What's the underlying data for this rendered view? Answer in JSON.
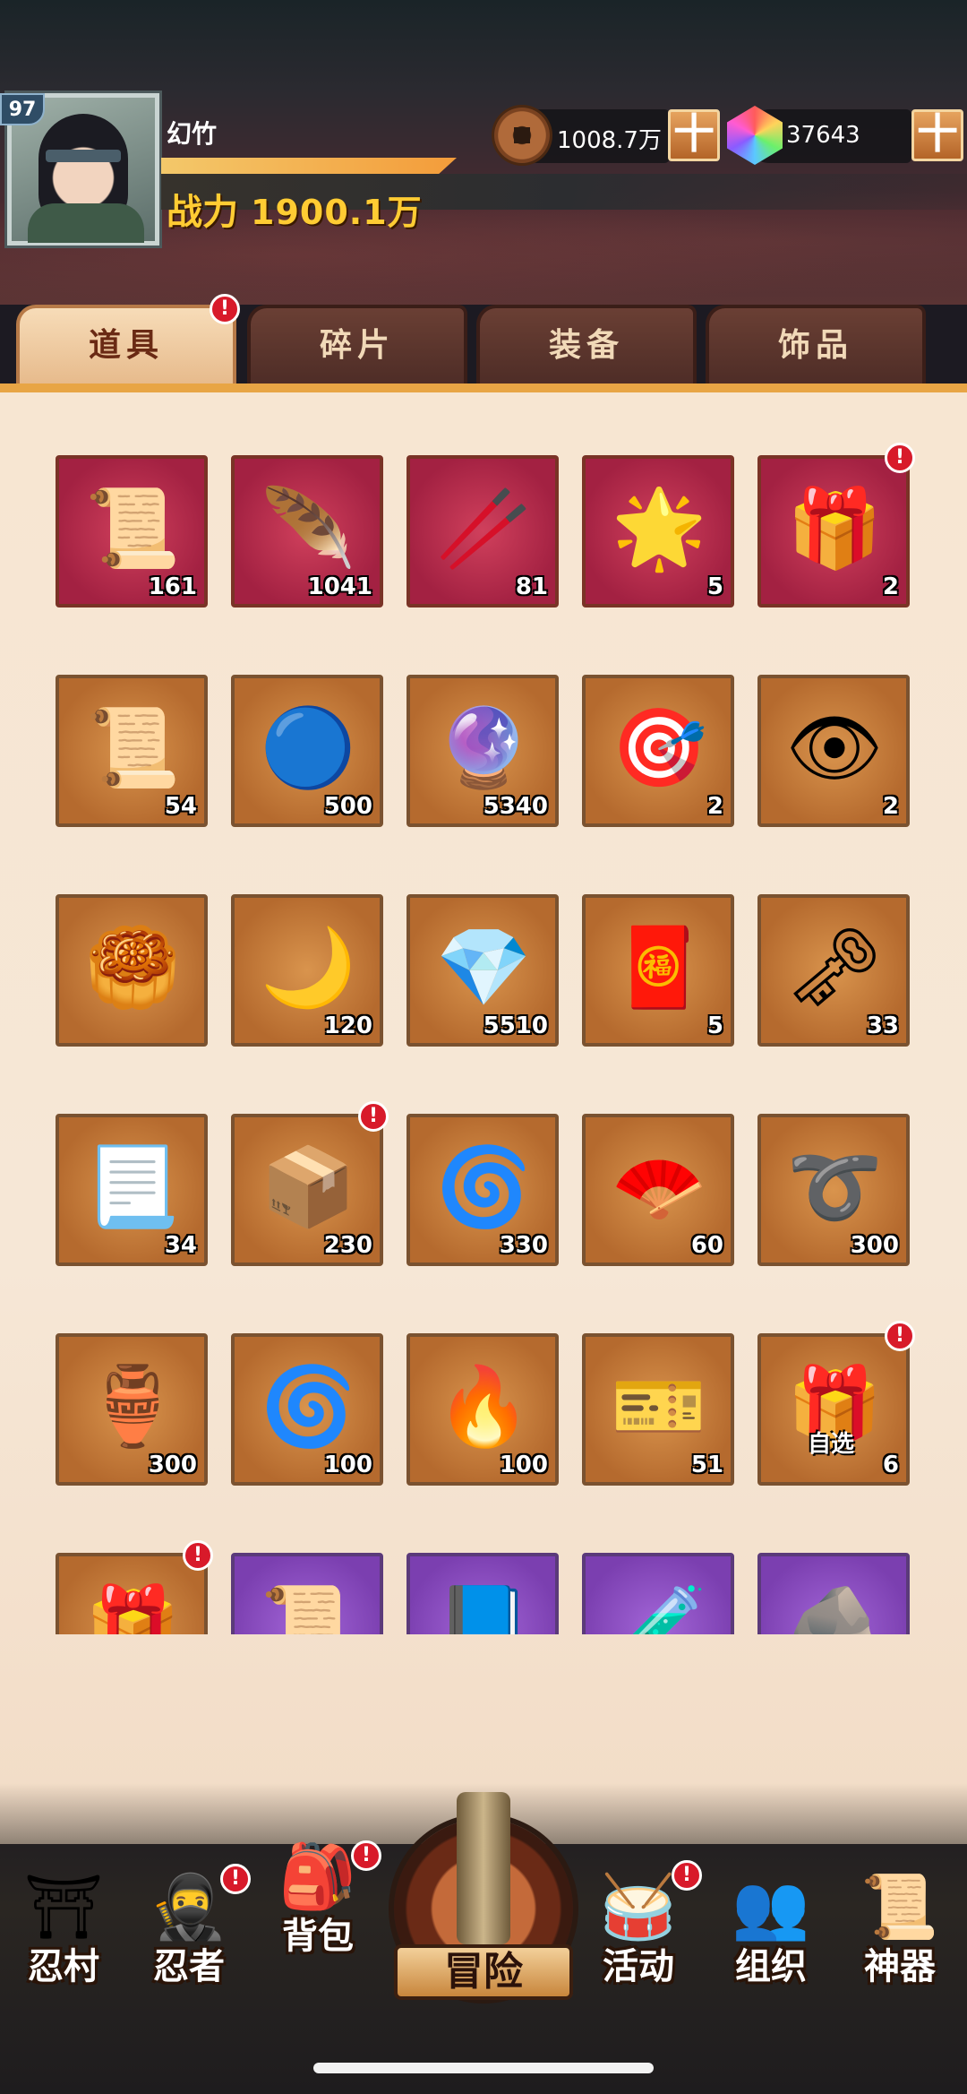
{
  "player": {
    "level": "97",
    "name": "幻竹",
    "power_label": "战力",
    "power_value": "1900.1万"
  },
  "currencies": {
    "coins": "1008.7万",
    "gems": "37643",
    "plus_label": "十"
  },
  "tabs": [
    {
      "label": "道具",
      "active": true,
      "alert": true
    },
    {
      "label": "碎片",
      "active": false,
      "alert": false
    },
    {
      "label": "装备",
      "active": false,
      "alert": false
    },
    {
      "label": "饰品",
      "active": false,
      "alert": false
    }
  ],
  "alert_mark": "!",
  "items": [
    {
      "icon": "scroll-icon",
      "glyph": "📜",
      "count": "161",
      "rarity": "red"
    },
    {
      "icon": "phoenix-feather-icon",
      "glyph": "🪶",
      "count": "1041",
      "rarity": "red"
    },
    {
      "icon": "wooden-stick-icon",
      "glyph": "🥢",
      "count": "81",
      "rarity": "red"
    },
    {
      "icon": "golden-feather-icon",
      "glyph": "🌟",
      "count": "5",
      "rarity": "red"
    },
    {
      "icon": "gift-box-icon",
      "glyph": "🎁",
      "count": "2",
      "rarity": "red",
      "alert": true
    },
    {
      "icon": "open-scroll-icon",
      "glyph": "📜",
      "count": "54",
      "rarity": "orange"
    },
    {
      "icon": "blue-orb-icon",
      "glyph": "🔵",
      "count": "500",
      "rarity": "orange"
    },
    {
      "icon": "purple-orb-icon",
      "glyph": "🔮",
      "count": "5340",
      "rarity": "orange"
    },
    {
      "icon": "red-target-token-icon",
      "glyph": "🎯",
      "count": "2",
      "rarity": "orange"
    },
    {
      "icon": "red-eye-token-icon",
      "glyph": "👁",
      "count": "2",
      "rarity": "orange"
    },
    {
      "icon": "gold-token-icon",
      "glyph": "🥮",
      "count": "",
      "rarity": "orange"
    },
    {
      "icon": "blue-moon-icon",
      "glyph": "🌙",
      "count": "120",
      "rarity": "orange"
    },
    {
      "icon": "purple-crystal-icon",
      "glyph": "💎",
      "count": "5510",
      "rarity": "orange"
    },
    {
      "icon": "fortune-banner-icon",
      "glyph": "🧧",
      "count": "5",
      "rarity": "orange"
    },
    {
      "icon": "key-icon",
      "glyph": "🗝",
      "count": "33",
      "rarity": "orange"
    },
    {
      "icon": "talisman-icon",
      "glyph": "📃",
      "count": "34",
      "rarity": "orange"
    },
    {
      "icon": "golden-chest-icon",
      "glyph": "📦",
      "count": "230",
      "rarity": "orange",
      "alert": true
    },
    {
      "icon": "shuriken-wheel-icon",
      "glyph": "🌀",
      "count": "330",
      "rarity": "orange"
    },
    {
      "icon": "red-fan-icon",
      "glyph": "🪭",
      "count": "60",
      "rarity": "orange"
    },
    {
      "icon": "rope-coil-icon",
      "glyph": "➰",
      "count": "300",
      "rarity": "orange"
    },
    {
      "icon": "clay-jar-icon",
      "glyph": "🏺",
      "count": "300",
      "rarity": "orange"
    },
    {
      "icon": "kunai-wheel-icon",
      "glyph": "🌀",
      "count": "100",
      "rarity": "orange"
    },
    {
      "icon": "blue-flame-orb-icon",
      "glyph": "🔥",
      "count": "100",
      "rarity": "orange"
    },
    {
      "icon": "awaken-ticket-icon",
      "glyph": "🎫",
      "count": "51",
      "rarity": "orange"
    },
    {
      "icon": "select-chest-icon",
      "glyph": "🎁",
      "count": "6",
      "rarity": "orange",
      "alert": true,
      "tag": "自选"
    },
    {
      "icon": "red-chest-icon",
      "glyph": "🎁",
      "count": "",
      "rarity": "orange",
      "alert": true
    },
    {
      "icon": "purple-scroll-icon",
      "glyph": "📜",
      "count": "",
      "rarity": "purple"
    },
    {
      "icon": "upgrade-book-icon",
      "glyph": "📘",
      "count": "",
      "rarity": "purple"
    },
    {
      "icon": "potion-bottle-icon",
      "glyph": "🧪",
      "count": "",
      "rarity": "purple"
    },
    {
      "icon": "ore-stone-icon",
      "glyph": "🪨",
      "count": "",
      "rarity": "purple"
    }
  ],
  "nav": {
    "village": {
      "label": "忍村",
      "icon": "gate-icon",
      "glyph": "⛩"
    },
    "ninja": {
      "label": "忍者",
      "icon": "ninja-icon",
      "glyph": "🥷",
      "alert": true
    },
    "bag": {
      "label": "背包",
      "icon": "backpack-icon",
      "glyph": "🎒",
      "alert": true
    },
    "adventure": {
      "label": "冒险",
      "icon": "scroll-emblem-icon"
    },
    "events": {
      "label": "活动",
      "icon": "drum-icon",
      "glyph": "🥁",
      "alert": true
    },
    "guild": {
      "label": "组织",
      "icon": "ninja-group-icon",
      "glyph": "👥"
    },
    "artifact": {
      "label": "神器",
      "icon": "artifact-scroll-icon",
      "glyph": "📜"
    }
  }
}
